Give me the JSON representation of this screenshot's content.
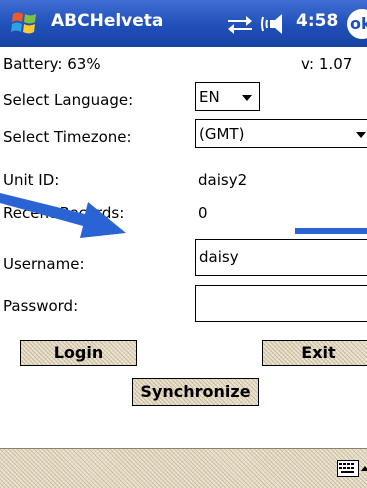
{
  "titlebar": {
    "app_title": "ABCHelveta",
    "clock": "4:58",
    "ok_label": "ok",
    "icons": [
      "windows-start-icon",
      "connectivity-icon",
      "volume-icon"
    ]
  },
  "status": {
    "battery": "Battery: 63%",
    "version": "v: 1.07"
  },
  "form": {
    "language_label": "Select Language:",
    "language_value": "EN",
    "timezone_label": "Select Timezone:",
    "timezone_value": "(GMT)",
    "unit_id_label": "Unit ID:",
    "unit_id_value": "daisy2",
    "recent_records_label": "Recent Records:",
    "recent_records_value": "0",
    "username_label": "Username:",
    "username_value": "daisy",
    "password_label": "Password:",
    "password_value": ""
  },
  "buttons": {
    "login": "Login",
    "exit": "Exit",
    "synchronize": "Synchronize"
  },
  "bottombar": {
    "icons": [
      "keyboard-icon",
      "sip-arrow-icon"
    ]
  },
  "colors": {
    "titlebar": "#1f4fb8",
    "button_face": "#e6dcc4",
    "annotation_arrow": "#2a63d4"
  }
}
